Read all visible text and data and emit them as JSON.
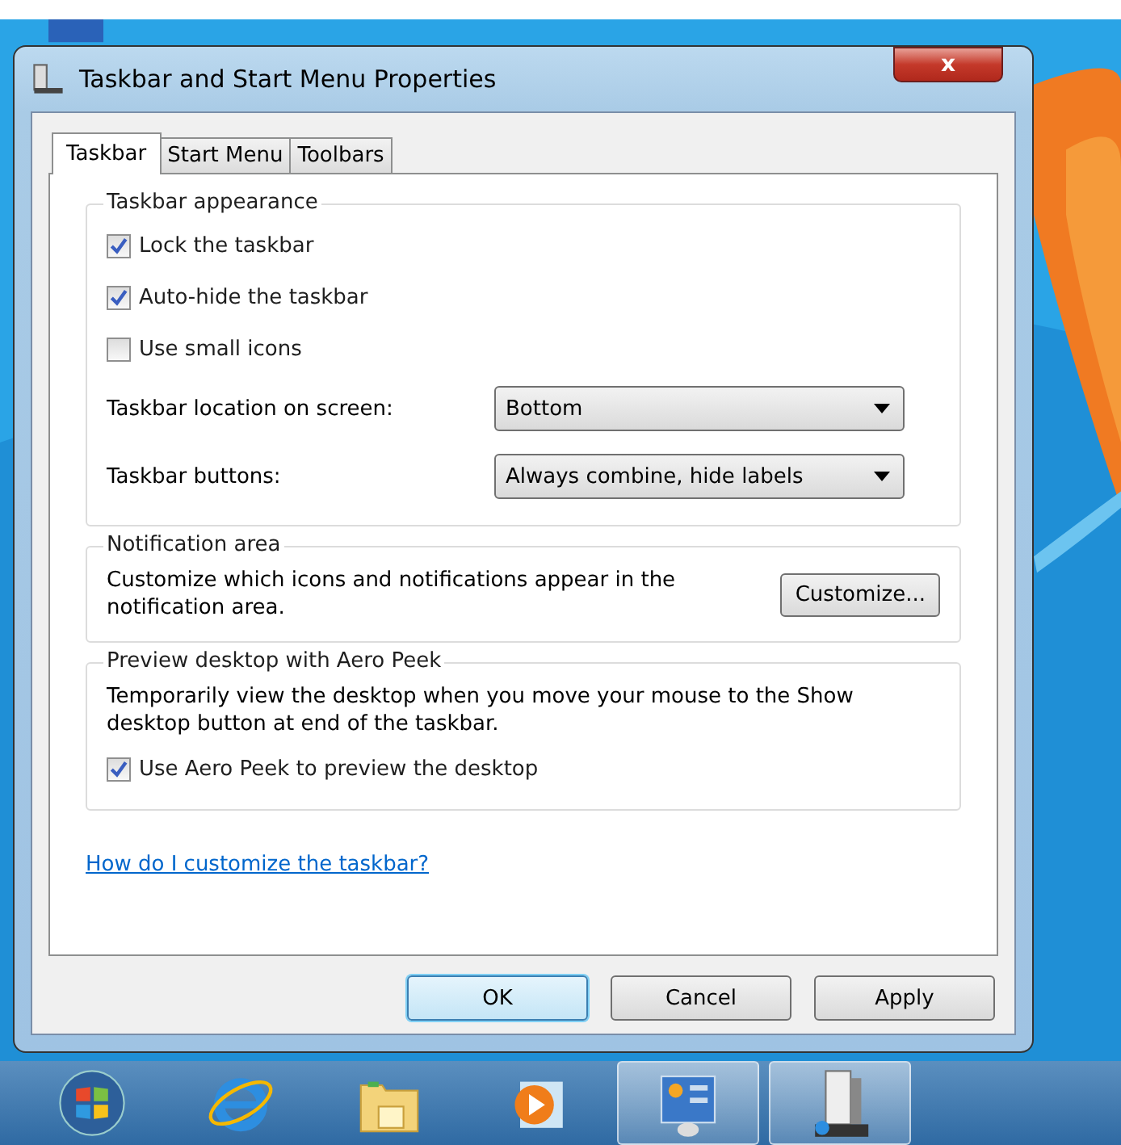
{
  "window": {
    "title": "Taskbar and Start Menu Properties",
    "close": "x"
  },
  "tabs": [
    {
      "label": "Taskbar",
      "selected": true
    },
    {
      "label": "Start Menu",
      "selected": false
    },
    {
      "label": "Toolbars",
      "selected": false
    }
  ],
  "appearance": {
    "title": "Taskbar appearance",
    "checkboxes": [
      {
        "label": "Lock the taskbar",
        "checked": true
      },
      {
        "label": "Auto-hide the taskbar",
        "checked": true
      },
      {
        "label": "Use small icons",
        "checked": false
      }
    ],
    "dropdowns": [
      {
        "label": "Taskbar location on screen:",
        "value": "Bottom"
      },
      {
        "label": "Taskbar buttons:",
        "value": "Always combine, hide labels"
      }
    ]
  },
  "notification": {
    "title": "Notification area",
    "text": "Customize which icons and notifications appear in the notification area.",
    "button": "Customize..."
  },
  "aero": {
    "title": "Preview desktop with Aero Peek",
    "text": "Temporarily view the desktop when you move your mouse to the Show desktop button at end of the taskbar.",
    "checkbox": {
      "label": "Use Aero Peek to preview the desktop",
      "checked": true
    }
  },
  "help_link": "How do I customize the taskbar?",
  "buttons": [
    {
      "label": "OK",
      "default": true
    },
    {
      "label": "Cancel",
      "default": false
    },
    {
      "label": "Apply",
      "default": false
    }
  ],
  "taskbar": {
    "items": [
      {
        "kind": "start",
        "active": false
      },
      {
        "kind": "browser",
        "active": false
      },
      {
        "kind": "folder",
        "active": false
      },
      {
        "kind": "media",
        "active": false
      },
      {
        "kind": "control-panel",
        "active": true
      },
      {
        "kind": "properties",
        "active": true
      }
    ]
  }
}
